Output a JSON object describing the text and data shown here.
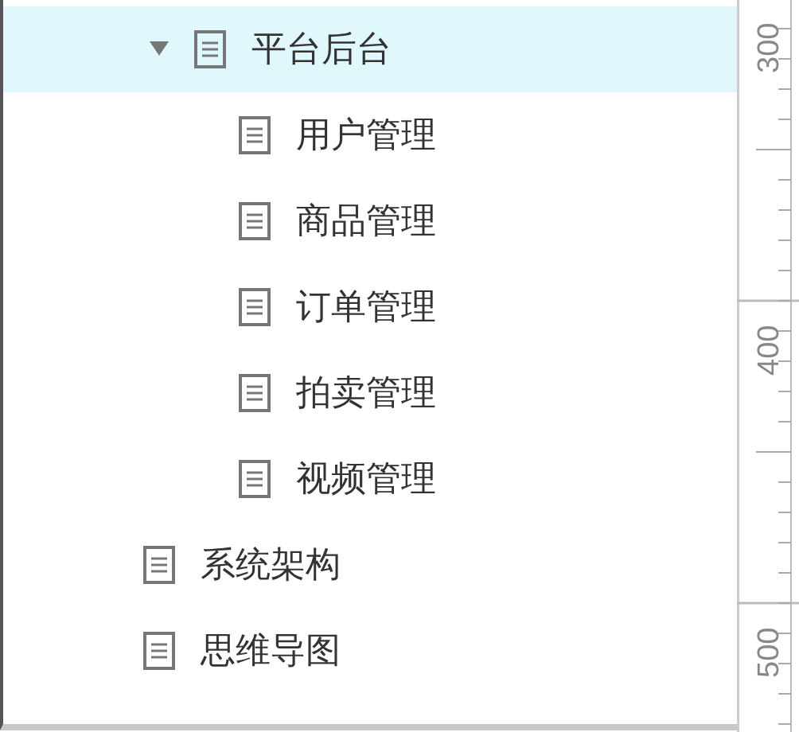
{
  "tree": {
    "items": [
      {
        "label": "平台后台",
        "selected": true,
        "expanded": true,
        "children": [
          {
            "label": "用户管理",
            "selected": false
          },
          {
            "label": "商品管理",
            "selected": false
          },
          {
            "label": "订单管理",
            "selected": false
          },
          {
            "label": "拍卖管理",
            "selected": false
          },
          {
            "label": "视频管理",
            "selected": false
          }
        ]
      },
      {
        "label": "系统架构",
        "selected": false
      },
      {
        "label": "思维导图",
        "selected": false
      }
    ]
  },
  "ruler": {
    "labels": [
      "300",
      "400",
      "500"
    ]
  }
}
